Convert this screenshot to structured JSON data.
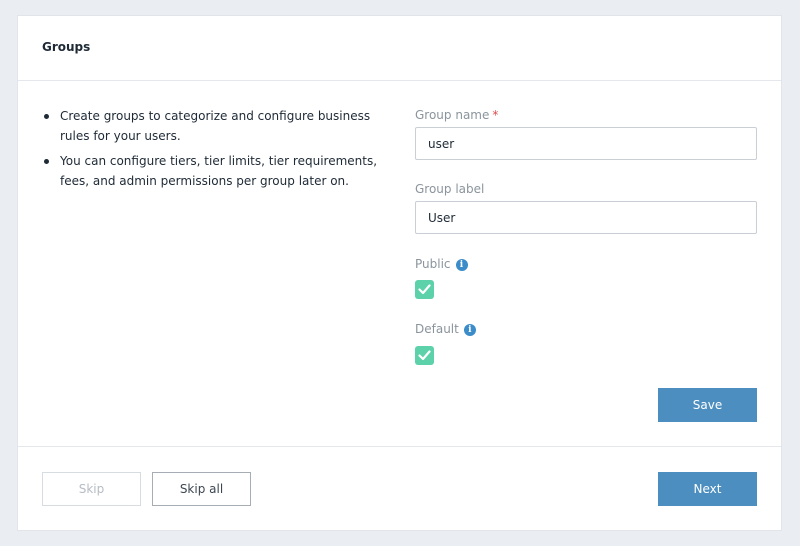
{
  "header": {
    "title": "Groups"
  },
  "info": {
    "items": [
      "Create groups to categorize and configure business rules for your users.",
      "You can configure tiers, tier limits, tier requirements, fees, and admin permissions per group later on."
    ]
  },
  "form": {
    "group_name": {
      "label": "Group name",
      "required_mark": "*",
      "value": "user"
    },
    "group_label": {
      "label": "Group label",
      "value": "User"
    },
    "public": {
      "label": "Public",
      "checked": true,
      "info_icon": "info-icon"
    },
    "default": {
      "label": "Default",
      "checked": true,
      "info_icon": "info-icon"
    },
    "save_label": "Save"
  },
  "footer": {
    "skip_label": "Skip",
    "skip_all_label": "Skip all",
    "next_label": "Next"
  },
  "colors": {
    "primary": "#4d8ec0",
    "checkbox": "#5dd1a9",
    "info_icon": "#3b8cc9",
    "required": "#e04b4b",
    "background": "#eaedf1"
  }
}
